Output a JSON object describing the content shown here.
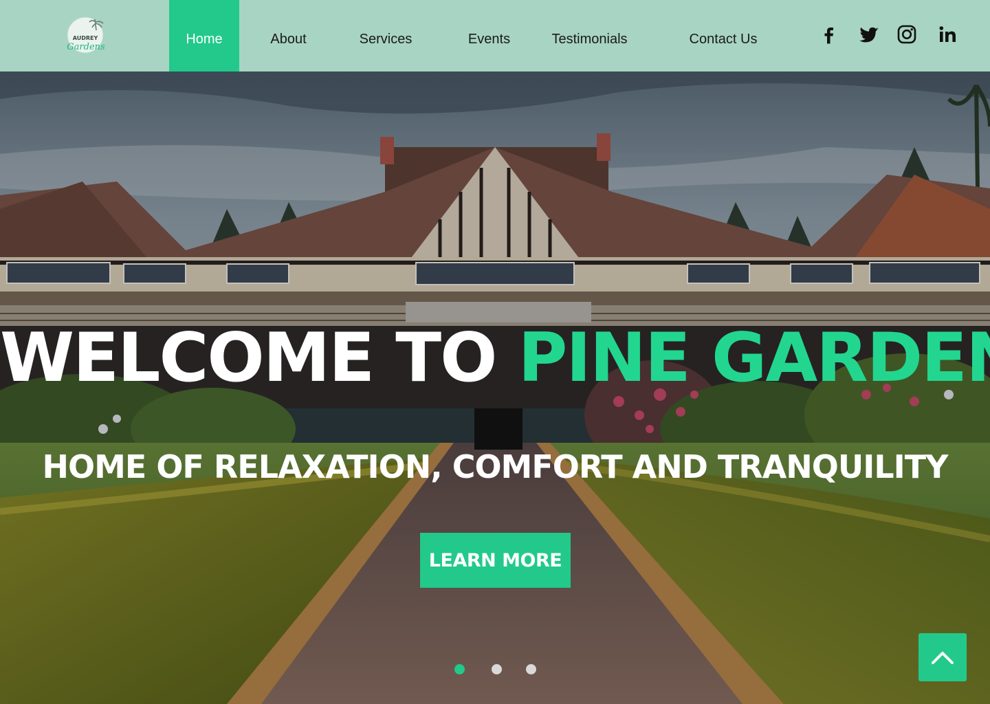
{
  "header": {
    "logo": {
      "line1": "AUDREY",
      "line2": "Gardens"
    },
    "nav": [
      {
        "label": "Home",
        "active": true
      },
      {
        "label": "About",
        "active": false
      },
      {
        "label": "Services",
        "active": false
      },
      {
        "label": "Events",
        "active": false
      },
      {
        "label": "Testimonials",
        "active": false
      },
      {
        "label": "Contact Us",
        "active": false
      }
    ],
    "social": [
      "facebook-icon",
      "twitter-icon",
      "instagram-icon",
      "linkedin-icon"
    ]
  },
  "hero": {
    "headline_white": "WELCOME TO",
    "headline_green": "PINE GARDENS",
    "subheadline": "HOME OF RELAXATION, COMFORT AND TRANQUILITY",
    "cta_label": "LEARN MORE",
    "slides": {
      "count": 3,
      "active": 1
    }
  },
  "colors": {
    "header_bg": "#a8d4c3",
    "accent": "#22c98b",
    "headline_green": "#22d68f"
  }
}
